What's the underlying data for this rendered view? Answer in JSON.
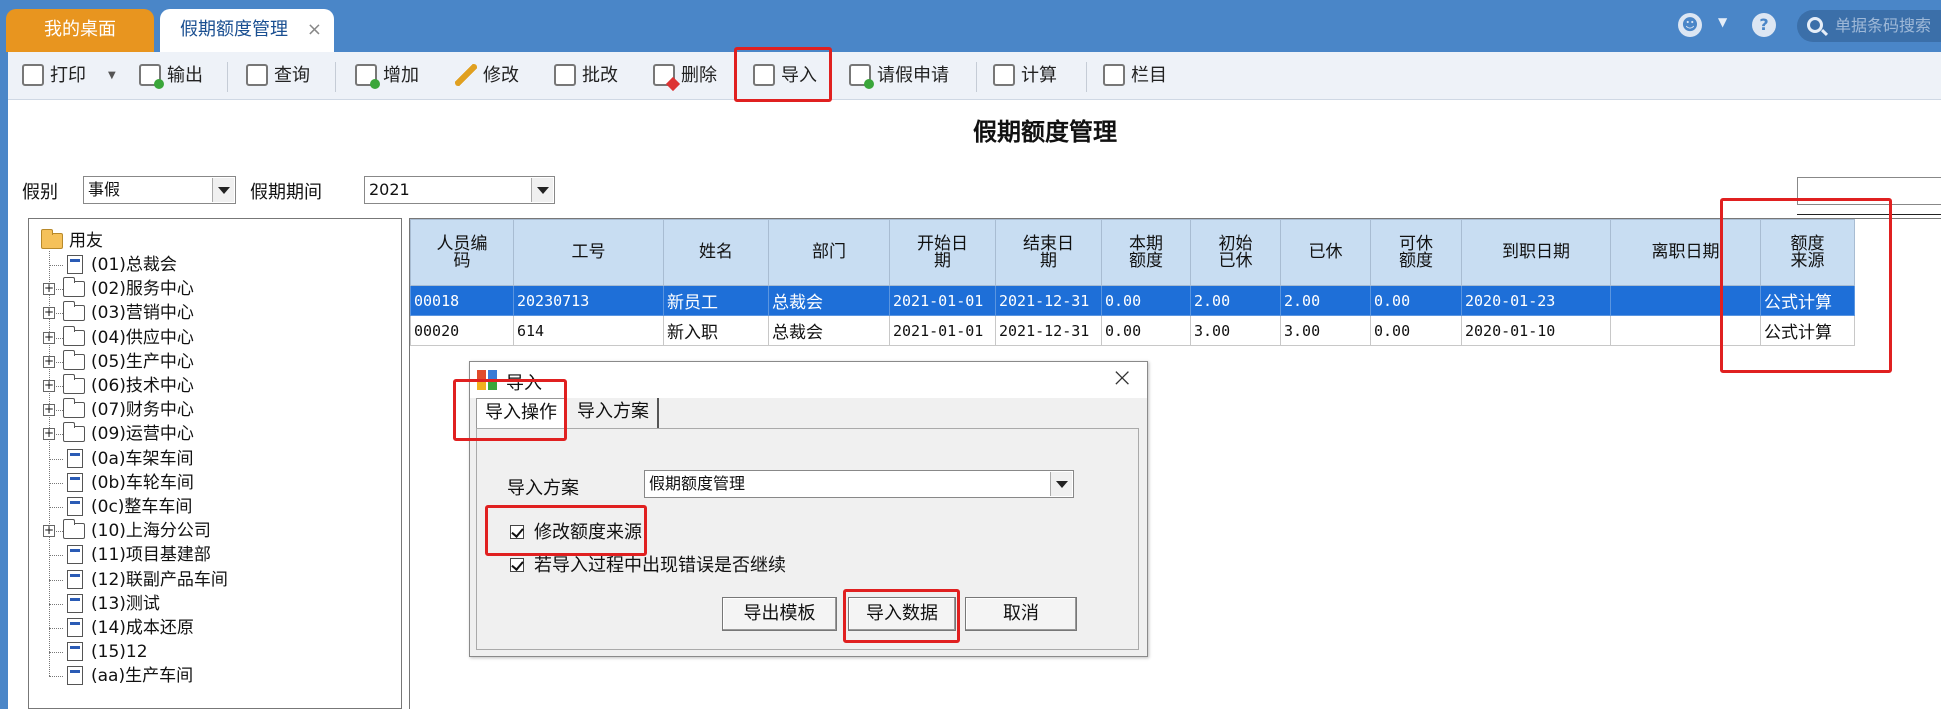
{
  "tabs": {
    "desktop": "我的桌面",
    "active": "假期额度管理",
    "close": "×"
  },
  "topbar": {
    "search_placeholder": "单据条码搜索",
    "help": "?",
    "smiley": "☻",
    "dropdown": "▼"
  },
  "toolbar": {
    "print": "打印",
    "print_dd": "▼",
    "export": "输出",
    "query": "查询",
    "add": "增加",
    "edit": "修改",
    "batch_edit": "批改",
    "delete": "删除",
    "import": "导入",
    "leave_request": "请假申请",
    "calculate": "计算",
    "columns": "栏目"
  },
  "page_title": "假期额度管理",
  "filters": {
    "leave_type_label": "假别",
    "leave_type_value": "事假",
    "period_label": "假期期间",
    "period_value": "2021"
  },
  "tree": {
    "root": "用友",
    "items": [
      "(01)总裁会",
      "(02)服务中心",
      "(03)营销中心",
      "(04)供应中心",
      "(05)生产中心",
      "(06)技术中心",
      "(07)财务中心",
      "(09)运营中心",
      "(0a)车架车间",
      "(0b)车轮车间",
      "(0c)整车车间",
      "(10)上海分公司",
      "(11)项目基建部",
      "(12)联副产品车间",
      "(13)测试",
      "(14)成本还原",
      "(15)12",
      "(aa)生产车间"
    ]
  },
  "grid": {
    "headers": [
      [
        "人员编",
        "码"
      ],
      [
        "工号"
      ],
      [
        "姓名"
      ],
      [
        "部门"
      ],
      [
        "开始日",
        "期"
      ],
      [
        "结束日",
        "期"
      ],
      [
        "本期",
        "额度"
      ],
      [
        "初始",
        "已休"
      ],
      [
        "已休"
      ],
      [
        "可休",
        "额度"
      ],
      [
        "到职日期"
      ],
      [
        "离职日期"
      ],
      [
        "额度",
        "来源"
      ]
    ],
    "rows": [
      [
        "00018",
        "20230713",
        "新员工",
        "总裁会",
        "2021-01-01",
        "2021-12-31",
        "0.00",
        "2.00",
        "2.00",
        "0.00",
        "2020-01-23",
        "",
        "公式计算"
      ],
      [
        "00020",
        "614",
        "新入职",
        "总裁会",
        "2021-01-01",
        "2021-12-31",
        "0.00",
        "3.00",
        "3.00",
        "0.00",
        "2020-01-10",
        "",
        "公式计算"
      ]
    ]
  },
  "dialog": {
    "title": "导入",
    "close": "×",
    "tab_operation": "导入操作",
    "tab_scheme": "导入方案",
    "scheme_label": "导入方案",
    "scheme_value": "假期额度管理",
    "chk_modify_source": "修改额度来源",
    "chk_continue_on_error": "若导入过程中出现错误是否继续",
    "btn_export_template": "导出模板",
    "btn_import_data": "导入数据",
    "btn_cancel": "取消"
  },
  "colors": {
    "accent": "#4a86c8",
    "desktop_tab": "#e8951f",
    "selection": "#1e6fd8",
    "highlight": "#e02020"
  }
}
